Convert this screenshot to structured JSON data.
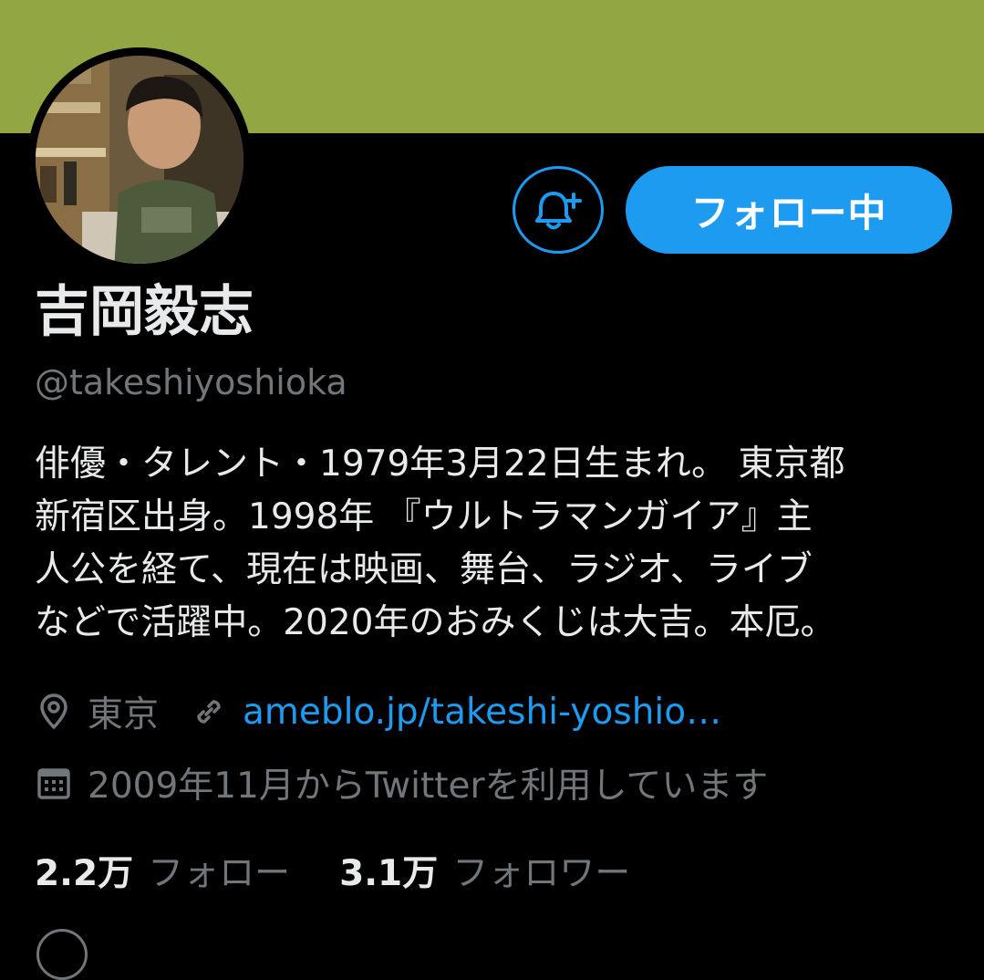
{
  "profile": {
    "display_name": "吉岡毅志",
    "handle": "@takeshiyoshioka",
    "bio_lines": [
      "俳優・タレント・1979年3月22日生まれ。 東京都",
      "新宿区出身。1998年 『ウルトラマンガイア』主",
      "人公を経て、現在は映画、舞台、ラジオ、ライブ",
      "などで活躍中。2020年のおみくじは大吉。本厄。"
    ],
    "location": "東京",
    "website": "ameblo.jp/takeshi-yoshio…",
    "joined": "2009年11月からTwitterを利用しています"
  },
  "buttons": {
    "notify_icon": "bell-plus-icon",
    "follow_label": "フォロー中"
  },
  "stats": {
    "following_count": "2.2万",
    "following_label": "フォロー",
    "followers_count": "3.1万",
    "followers_label": "フォロワー"
  },
  "icons": {
    "location": "location-pin-icon",
    "link": "link-icon",
    "calendar": "calendar-icon"
  },
  "colors": {
    "banner": "#92a743",
    "accent": "#1d9bf0",
    "background": "#000000",
    "primary_text": "#e7e9ea",
    "secondary_text": "#71767b"
  }
}
